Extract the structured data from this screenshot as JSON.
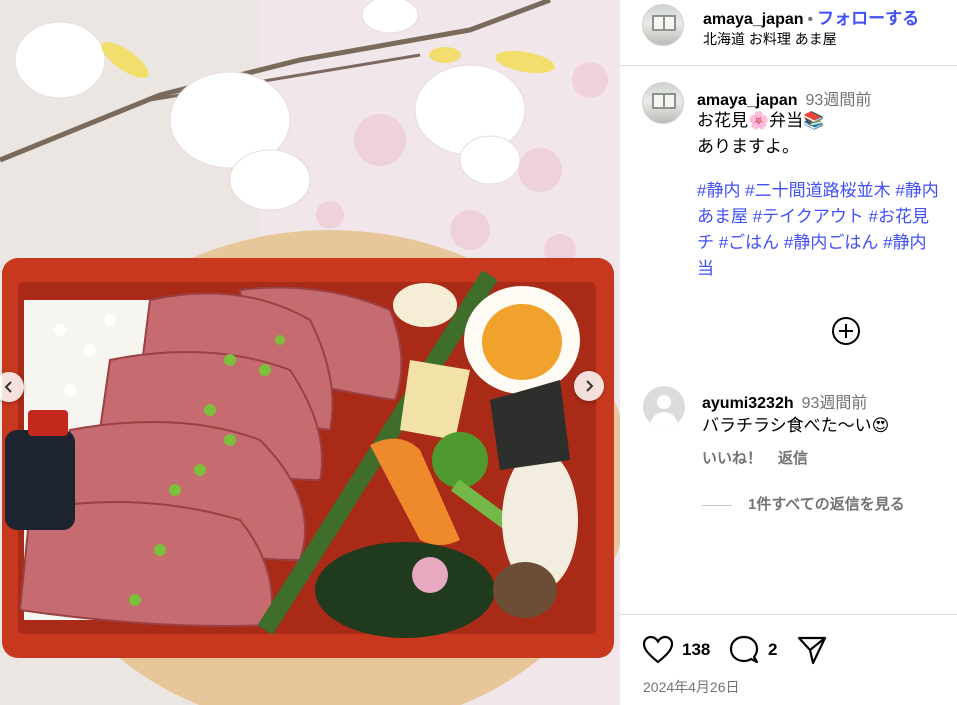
{
  "post": {
    "username": "amaya_japan",
    "follow_label": "フォローする",
    "location": "北海道 お料理 あま屋"
  },
  "caption": {
    "username": "amaya_japan",
    "time": "93週間前",
    "line1": "お花見🌸弁当📚",
    "line2": "ありますよ。",
    "hashtag_lines": [
      "#静内 #二十間道路桜並木 #静内",
      "あま屋 #テイクアウト #お花見",
      "チ #ごはん #静内ごはん #静内",
      "当"
    ]
  },
  "reply": {
    "username": "ayumi3232h",
    "time": "93週間前",
    "text": "バラチラシ食べた〜い😍",
    "like_label": "いいね！",
    "reply_label": "返信",
    "view_replies_label": "1件すべての返信を見る"
  },
  "actions": {
    "likes": "138",
    "comments": "2"
  },
  "date": "2024年4月26日",
  "icons": {
    "more_comments": "plus-circle-icon",
    "like": "heart-icon",
    "comment": "comment-bubble-icon",
    "share": "paper-plane-icon",
    "prev": "chevron-left-icon",
    "next": "chevron-right-icon"
  },
  "colors": {
    "link_blue": "#4150f7",
    "muted_gray": "#737373",
    "divider": "#dbdbdb"
  }
}
